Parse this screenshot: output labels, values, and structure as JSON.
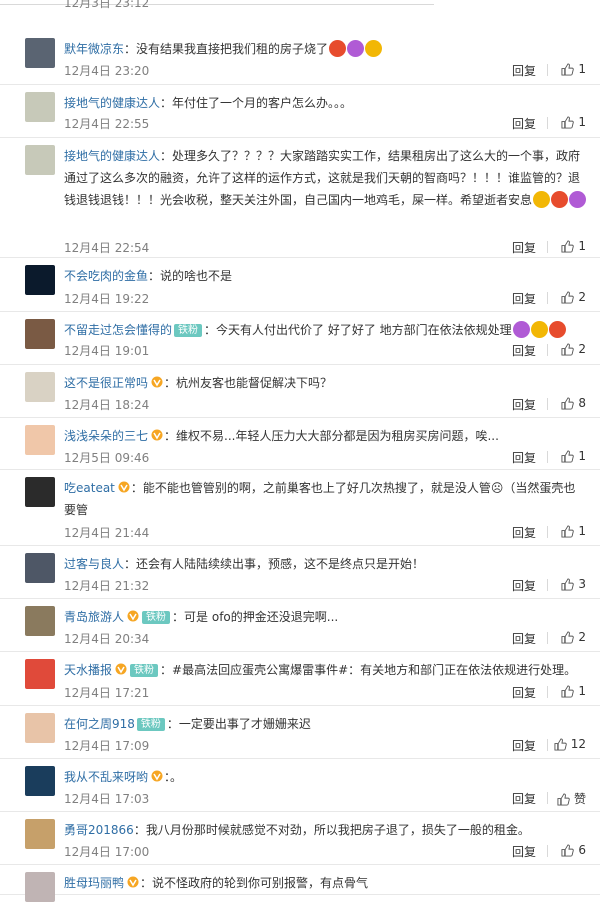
{
  "header": {
    "cutoff_text": "12月3日 23:12"
  },
  "comments": [
    {
      "user": "默年微凉东",
      "vip": false,
      "badge": "",
      "text": "没有结果我直接把我们租的房子烧了",
      "emoji_count": 3,
      "time": "12月4日 23:20",
      "reply": "回复",
      "likes": "1"
    },
    {
      "user": "接地气的健康达人",
      "vip": false,
      "badge": "",
      "text": "年付住了一个月的客户怎么办。。。",
      "emoji_count": 0,
      "time": "12月4日 22:55",
      "reply": "回复",
      "likes": "1"
    },
    {
      "user": "接地气的健康达人",
      "vip": false,
      "badge": "",
      "text": "处理多久了？？？？大家踏踏实实工作，结果租房出了这么大的一个事，政府通过了这么多次的融资，允许了这样的运作方式，这就是我们天朝的智商吗？！！！谁监管的？退钱退钱退钱！！！光会收税，整天关注外国，自己国内一地鸡毛，屎一样。希望逝者安息",
      "emoji_count": 3,
      "time": "12月4日 22:54",
      "reply": "回复",
      "likes": "1"
    },
    {
      "user": "不会吃肉的金鱼",
      "vip": false,
      "badge": "",
      "text": "说的啥也不是",
      "emoji_count": 0,
      "time": "12月4日 19:22",
      "reply": "回复",
      "likes": "2"
    },
    {
      "user": "不留走过怎会懂得的",
      "vip": false,
      "badge": "铁粉",
      "text": "今天有人付出代价了    好了好了  地方部门在依法依规处理",
      "emoji_count": 3,
      "time": "12月4日 19:01",
      "reply": "回复",
      "likes": "2"
    },
    {
      "user": "这不是很正常吗",
      "vip": true,
      "badge": "",
      "text": "杭州友客也能督促解决下吗？",
      "emoji_count": 0,
      "time": "12月4日 18:24",
      "reply": "回复",
      "likes": "8"
    },
    {
      "user": "浅浅朵朵的三七",
      "vip": true,
      "badge": "",
      "text": "维权不易...年轻人压力大大部分都是因为租房买房问题，唉...",
      "emoji_count": 0,
      "time": "12月5日 09:46",
      "reply": "回复",
      "likes": "1"
    },
    {
      "user": "吃eateat",
      "vip": true,
      "badge": "",
      "text": "能不能也管管别的啊，之前巢客也上了好几次热搜了，就是没人管☹（当然蛋壳也要管",
      "emoji_count": 0,
      "time": "12月4日 21:44",
      "reply": "回复",
      "likes": "1"
    },
    {
      "user": "过客与良人",
      "vip": false,
      "badge": "",
      "text": "还会有人陆陆续续出事，预感，这不是终点只是开始！",
      "emoji_count": 0,
      "time": "12月4日 21:32",
      "reply": "回复",
      "likes": "3"
    },
    {
      "user": "青岛旅游人",
      "vip": true,
      "badge": "铁粉",
      "text": "可是 ofo的押金还没退完啊...",
      "emoji_count": 0,
      "time": "12月4日 20:34",
      "reply": "回复",
      "likes": "2"
    },
    {
      "user": "天水播报",
      "vip": true,
      "badge": "铁粉",
      "text": "#最高法回应蛋壳公寓爆雷事件#：有关地方和部门正在依法依规进行处理。",
      "emoji_count": 0,
      "time": "12月4日 17:21",
      "reply": "回复",
      "likes": "1"
    },
    {
      "user": "在何之周918",
      "vip": false,
      "badge": "铁粉",
      "text": "一定要出事了才姗姗来迟",
      "emoji_count": 0,
      "time": "12月4日 17:09",
      "reply": "回复",
      "likes": "12"
    },
    {
      "user": "我从不乱来呀哟",
      "vip": true,
      "badge": "",
      "text": "。",
      "emoji_count": 0,
      "time": "12月4日 17:03",
      "reply": "回复",
      "likes": "赞"
    },
    {
      "user": "勇哥201866",
      "vip": false,
      "badge": "",
      "text": "我八月份那时候就感觉不对劲，所以我把房子退了，损失了一般的租金。",
      "emoji_count": 0,
      "time": "12月4日 17:00",
      "reply": "回复",
      "likes": "6"
    },
    {
      "user": "胜母玛丽鸭",
      "vip": true,
      "badge": "",
      "text": "说不怪政府的轮到你可别报警，有点骨气",
      "emoji_count": 0,
      "time": "",
      "reply": "",
      "likes": ""
    }
  ],
  "colors": {
    "username": "#eb7350",
    "meta": "#808080",
    "badge": "#6cc8c0"
  }
}
